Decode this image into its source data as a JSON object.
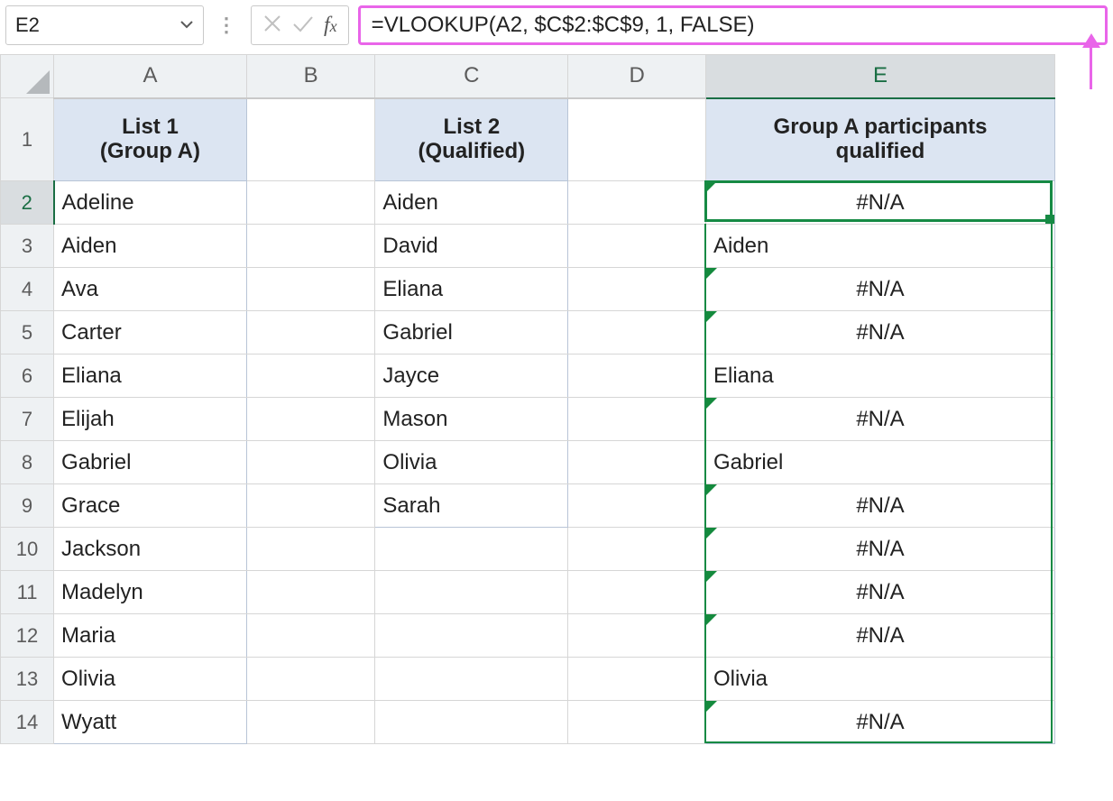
{
  "namebox": {
    "value": "E2"
  },
  "formula_bar": {
    "value": "=VLOOKUP(A2, $C$2:$C$9, 1, FALSE)"
  },
  "columns": [
    "A",
    "B",
    "C",
    "D",
    "E"
  ],
  "column_widths": {
    "A": 210,
    "B": 140,
    "C": 210,
    "D": 150,
    "E": 380
  },
  "active_column": "E",
  "active_row": 2,
  "header_row": {
    "A": [
      "List 1",
      "(Group A)"
    ],
    "C": [
      "List 2",
      "(Qualified)"
    ],
    "E": [
      "Group A participants",
      "qualified"
    ]
  },
  "rows": [
    {
      "n": 2,
      "A": "Adeline",
      "C": "Aiden",
      "E": "#N/A",
      "E_err": true,
      "E_align": "center"
    },
    {
      "n": 3,
      "A": "Aiden",
      "C": "David",
      "E": "Aiden",
      "E_err": false,
      "E_align": "left"
    },
    {
      "n": 4,
      "A": "Ava",
      "C": "Eliana",
      "E": "#N/A",
      "E_err": true,
      "E_align": "center"
    },
    {
      "n": 5,
      "A": "Carter",
      "C": "Gabriel",
      "E": "#N/A",
      "E_err": true,
      "E_align": "center"
    },
    {
      "n": 6,
      "A": "Eliana",
      "C": "Jayce",
      "E": "Eliana",
      "E_err": false,
      "E_align": "left"
    },
    {
      "n": 7,
      "A": "Elijah",
      "C": "Mason",
      "E": "#N/A",
      "E_err": true,
      "E_align": "center"
    },
    {
      "n": 8,
      "A": "Gabriel",
      "C": "Olivia",
      "E": "Gabriel",
      "E_err": false,
      "E_align": "left"
    },
    {
      "n": 9,
      "A": "Grace",
      "C": "Sarah",
      "E": "#N/A",
      "E_err": true,
      "E_align": "center"
    },
    {
      "n": 10,
      "A": "Jackson",
      "C": "",
      "E": "#N/A",
      "E_err": true,
      "E_align": "center"
    },
    {
      "n": 11,
      "A": "Madelyn",
      "C": "",
      "E": "#N/A",
      "E_err": true,
      "E_align": "center"
    },
    {
      "n": 12,
      "A": "Maria",
      "C": "",
      "E": "#N/A",
      "E_err": true,
      "E_align": "center"
    },
    {
      "n": 13,
      "A": "Olivia",
      "C": "",
      "E": "Olivia",
      "E_err": false,
      "E_align": "left"
    },
    {
      "n": 14,
      "A": "Wyatt",
      "C": "",
      "E": "#N/A",
      "E_err": true,
      "E_align": "center"
    }
  ],
  "colors": {
    "formula_highlight": "#e965e9",
    "selection_green": "#168a44",
    "header_fill": "#dce5f2"
  }
}
